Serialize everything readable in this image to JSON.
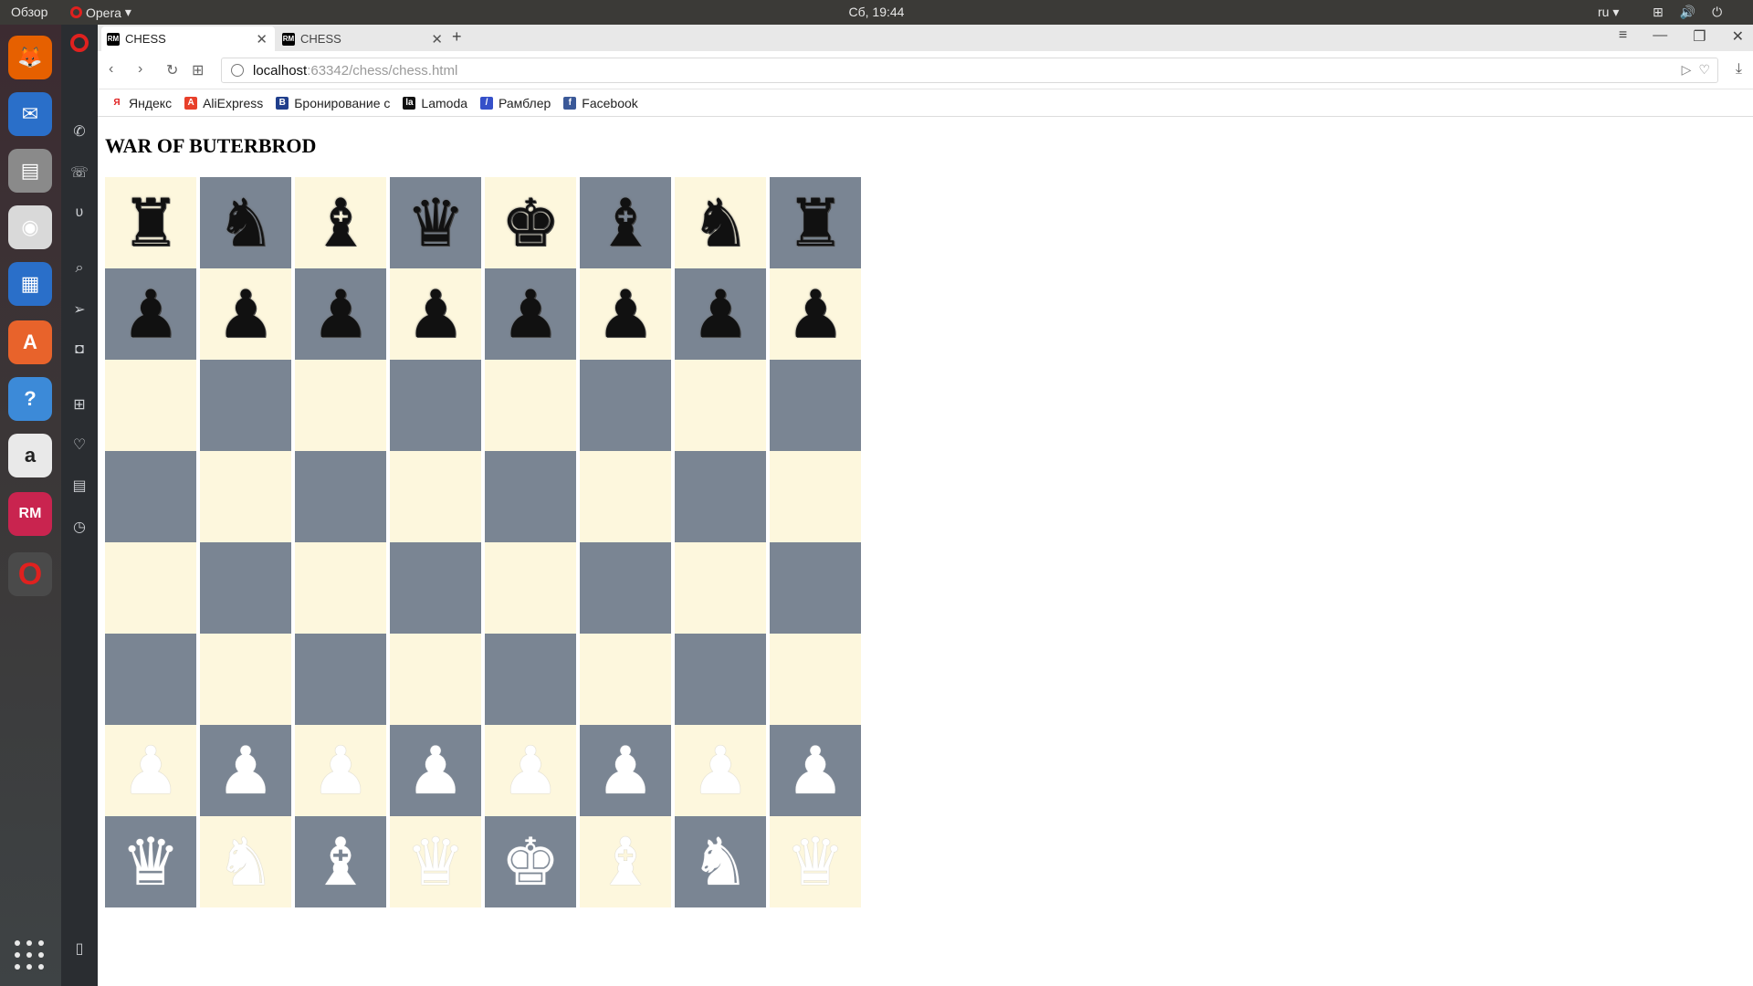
{
  "topbar": {
    "overview": "Обзор",
    "app_menu": "Opera",
    "clock": "Сб, 19:44",
    "language": "ru"
  },
  "browser": {
    "tabs": [
      {
        "label": "CHESS",
        "active": true
      },
      {
        "label": "CHESS",
        "active": false
      }
    ],
    "new_tab": "+",
    "url_host": "localhost",
    "url_rest": ":63342/chess/chess.html",
    "bookmarks": [
      {
        "label": "Яндекс",
        "icon": "Я",
        "color": "#ffffff",
        "fg": "#e01f1f"
      },
      {
        "label": "AliExpress",
        "icon": "A",
        "color": "#e8402a",
        "fg": "#ffffff"
      },
      {
        "label": "Бронирование с",
        "icon": "B",
        "color": "#1f3e8c",
        "fg": "#ffffff"
      },
      {
        "label": "Lamoda",
        "icon": "la",
        "color": "#111111",
        "fg": "#ffffff"
      },
      {
        "label": "Рамблер",
        "icon": "/",
        "color": "#3550c9",
        "fg": "#ffffff"
      },
      {
        "label": "Facebook",
        "icon": "f",
        "color": "#3b5998",
        "fg": "#ffffff"
      }
    ]
  },
  "page": {
    "title": "WAR OF BUTERBROD"
  },
  "board": {
    "light_color": "#fdf7dd",
    "dark_color": "#7a8593",
    "rows": [
      [
        {
          "p": "♜",
          "c": "black"
        },
        {
          "p": "♞",
          "c": "black"
        },
        {
          "p": "♝",
          "c": "black"
        },
        {
          "p": "♛",
          "c": "black"
        },
        {
          "p": "♚",
          "c": "black"
        },
        {
          "p": "♝",
          "c": "black"
        },
        {
          "p": "♞",
          "c": "black"
        },
        {
          "p": "♜",
          "c": "black"
        }
      ],
      [
        {
          "p": "♟",
          "c": "black"
        },
        {
          "p": "♟",
          "c": "black"
        },
        {
          "p": "♟",
          "c": "black"
        },
        {
          "p": "♟",
          "c": "black"
        },
        {
          "p": "♟",
          "c": "black"
        },
        {
          "p": "♟",
          "c": "black"
        },
        {
          "p": "♟",
          "c": "black"
        },
        {
          "p": "♟",
          "c": "black"
        }
      ],
      [
        null,
        null,
        null,
        null,
        null,
        null,
        null,
        null
      ],
      [
        null,
        null,
        null,
        null,
        null,
        null,
        null,
        null
      ],
      [
        null,
        null,
        null,
        null,
        null,
        null,
        null,
        null
      ],
      [
        null,
        null,
        null,
        null,
        null,
        null,
        null,
        null
      ],
      [
        {
          "p": "♟",
          "c": "white"
        },
        {
          "p": "♟",
          "c": "white"
        },
        {
          "p": "♟",
          "c": "white"
        },
        {
          "p": "♟",
          "c": "white"
        },
        {
          "p": "♟",
          "c": "white"
        },
        {
          "p": "♟",
          "c": "white"
        },
        {
          "p": "♟",
          "c": "white"
        },
        {
          "p": "♟",
          "c": "white"
        }
      ],
      [
        {
          "p": "♛",
          "c": "white"
        },
        {
          "p": "♞",
          "c": "white"
        },
        {
          "p": "♝",
          "c": "white"
        },
        {
          "p": "♛",
          "c": "white"
        },
        {
          "p": "♚",
          "c": "white"
        },
        {
          "p": "♝",
          "c": "white"
        },
        {
          "p": "♞",
          "c": "white"
        },
        {
          "p": "♛",
          "c": "white"
        }
      ]
    ],
    "first_square": "light"
  },
  "dock": {
    "apps": [
      {
        "name": "firefox-icon",
        "color": "#e66000",
        "glyph": "🦊"
      },
      {
        "name": "thunderbird-icon",
        "color": "#2a6fc9",
        "glyph": "✉"
      },
      {
        "name": "files-icon",
        "color": "#8a8a8a",
        "glyph": "▤"
      },
      {
        "name": "rhythmbox-icon",
        "color": "#d9d9d9",
        "glyph": "◉"
      },
      {
        "name": "writer-icon",
        "color": "#2a6fc9",
        "glyph": "▦"
      },
      {
        "name": "software-center-icon",
        "color": "#e8632b",
        "glyph": "A"
      },
      {
        "name": "help-icon",
        "color": "#3c8ad8",
        "glyph": "?"
      },
      {
        "name": "amazon-icon",
        "color": "#e9e9e9",
        "glyph": "a"
      },
      {
        "name": "rubymine-icon",
        "color": "#c9244f",
        "glyph": "RM"
      },
      {
        "name": "opera-icon",
        "color": "#4a4a4a",
        "glyph": "O"
      }
    ]
  }
}
